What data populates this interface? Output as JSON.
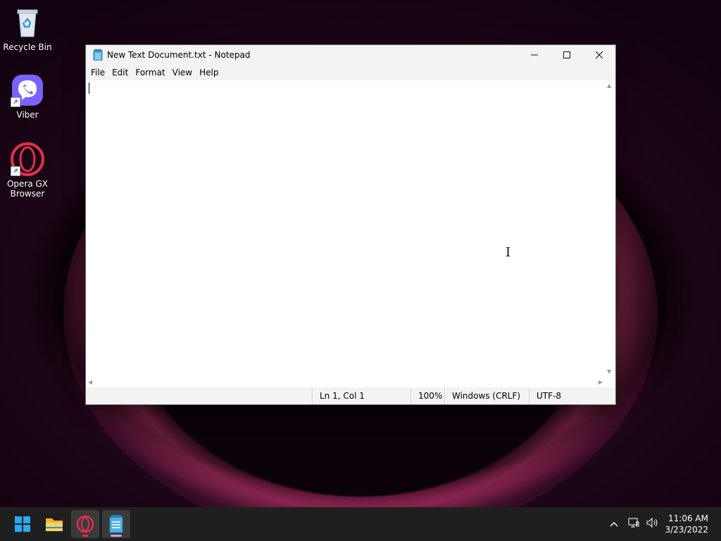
{
  "desktop": {
    "icons": [
      {
        "label": "Recycle Bin"
      },
      {
        "label": "Viber"
      },
      {
        "label": "Opera GX\nBrowser"
      }
    ]
  },
  "window": {
    "title": "New Text Document.txt - Notepad",
    "menu": [
      "File",
      "Edit",
      "Format",
      "View",
      "Help"
    ],
    "content": "",
    "status": {
      "position": "Ln 1, Col 1",
      "zoom": "100%",
      "line_ending": "Windows (CRLF)",
      "encoding": "UTF-8"
    }
  },
  "taskbar": {
    "apps": [
      "start-icon",
      "file-explorer-icon",
      "opera-gx-icon",
      "notepad-icon"
    ]
  },
  "clock": {
    "time": "11:06 AM",
    "date": "3/23/2022"
  },
  "colors": {
    "accent_opera": "#e0304e",
    "accent_start": "#2aa9f0",
    "taskbar_bg": "#1f1f1f"
  }
}
